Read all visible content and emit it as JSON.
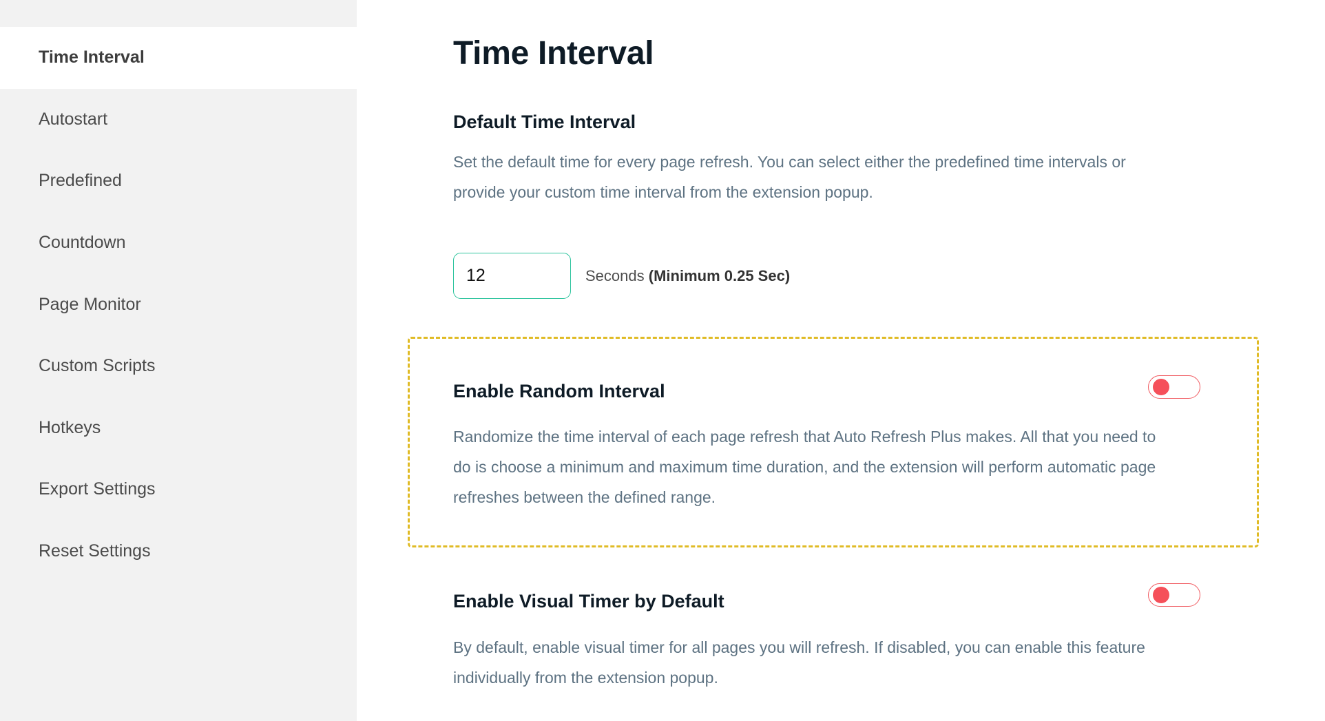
{
  "sidebar": {
    "items": [
      {
        "label": "Time Interval",
        "active": true
      },
      {
        "label": "Autostart",
        "active": false
      },
      {
        "label": "Predefined",
        "active": false
      },
      {
        "label": "Countdown",
        "active": false
      },
      {
        "label": "Page Monitor",
        "active": false
      },
      {
        "label": "Custom Scripts",
        "active": false
      },
      {
        "label": "Hotkeys",
        "active": false
      },
      {
        "label": "Export Settings",
        "active": false
      },
      {
        "label": "Reset Settings",
        "active": false
      }
    ]
  },
  "main": {
    "title": "Time Interval",
    "default_interval": {
      "heading": "Default Time Interval",
      "description": "Set the default time for every page refresh. You can select either the predefined time intervals or provide your custom time interval from the extension popup.",
      "input_value": "12",
      "unit_label": "Seconds",
      "min_note": "(Minimum 0.25 Sec)"
    },
    "random_interval": {
      "heading": "Enable Random Interval",
      "description": "Randomize the time interval of each page refresh that Auto Refresh Plus makes. All that you need to do is choose a minimum and maximum time duration, and the extension will perform automatic page refreshes between the defined range.",
      "enabled": false
    },
    "visual_timer": {
      "heading": "Enable Visual Timer by Default",
      "description": "By default, enable visual timer for all pages you will refresh. If disabled, you can enable this feature individually from the extension popup.",
      "enabled": false
    }
  },
  "colors": {
    "accent_input_border": "#2ec49e",
    "toggle_off": "#f5505a",
    "highlight_dashed": "#e0bb26",
    "sidebar_bg": "#f2f2f2"
  }
}
